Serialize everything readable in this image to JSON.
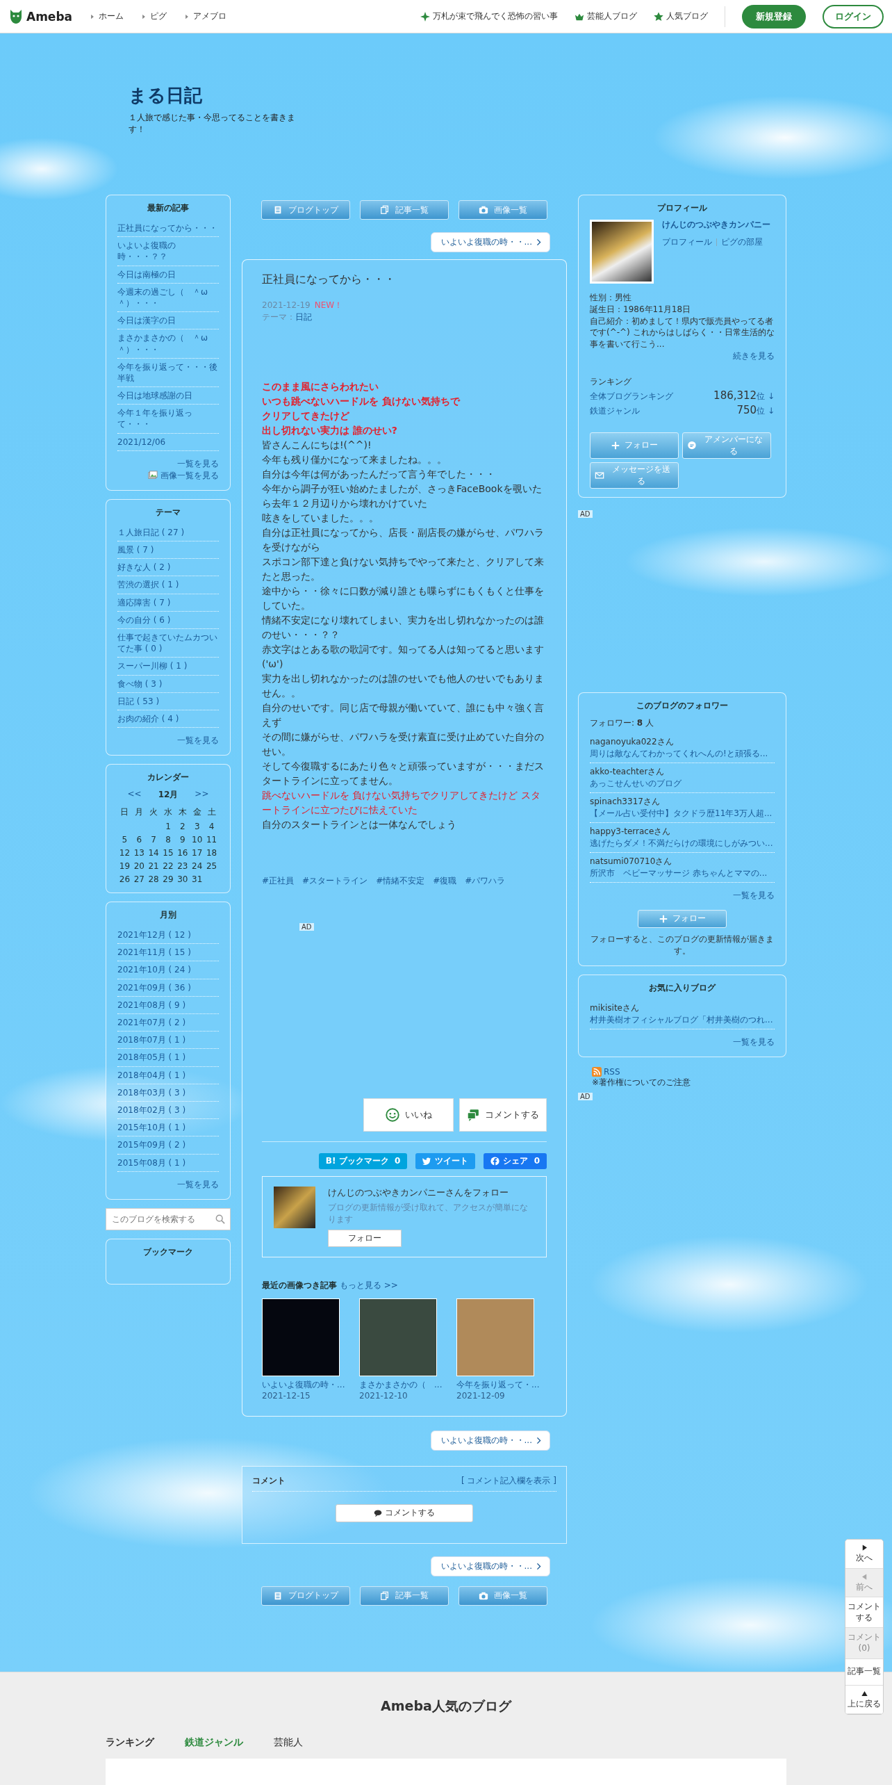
{
  "header": {
    "logo": "Ameba",
    "nav_links": [
      "ホーム",
      "ピグ",
      "アメブロ"
    ],
    "right_links": [
      {
        "text": "万札が束で飛んでく恐怖の習い事",
        "kind": "sparkle"
      },
      {
        "text": "芸能人ブログ",
        "kind": "crown"
      },
      {
        "text": "人気ブログ",
        "kind": "star"
      }
    ],
    "signup": "新規登録",
    "login": "ログイン"
  },
  "blog": {
    "title": "まる日記",
    "description": "１人旅で感じた事・今思ってることを書きます！"
  },
  "latest_articles": {
    "title": "最新の記事",
    "items": [
      "正社員になってから・・・",
      "いよいよ復職の時・・・？？",
      "今日は南極の日",
      "今週末の過ごし（　＾ω＾）・・・",
      "今日は漢字の日",
      "まさかまさかの（　＾ω＾）・・・",
      "今年を振り返って・・・後半戦",
      "今日は地球感謝の日",
      "今年１年を振り返って・・・",
      "2021/12/06"
    ],
    "more": "一覧を見る",
    "image_more": "画像一覧を見る"
  },
  "themes": {
    "title": "テーマ",
    "items": [
      "１人旅日記 ( 27 )",
      "風景 ( 7 )",
      "好きな人 ( 2 )",
      "苦渋の選択 ( 1 )",
      "適応障害 ( 7 )",
      "今の自分 ( 6 )",
      "仕事で起きていたムカついてた事 ( 0 )",
      "スーパー川柳 ( 1 )",
      "食べ物 ( 3 )",
      "日記 ( 53 )",
      "お肉の紹介 ( 4 )"
    ],
    "more": "一覧を見る"
  },
  "calendar": {
    "title": "カレンダー",
    "prev": "<<",
    "month": "12月",
    "next": ">>",
    "weekdays": [
      "日",
      "月",
      "火",
      "水",
      "木",
      "金",
      "土"
    ],
    "weeks": [
      [
        "1",
        "2",
        "3",
        "4"
      ],
      [
        "5",
        "6",
        "7",
        "8",
        "9",
        "10",
        "11"
      ],
      [
        "12",
        "13",
        "14",
        "15",
        "16",
        "17",
        "18"
      ],
      [
        "19",
        "20",
        "21",
        "22",
        "23",
        "24",
        "25"
      ],
      [
        "26",
        "27",
        "28",
        "29",
        "30",
        "31"
      ]
    ]
  },
  "monthly": {
    "title": "月別",
    "items": [
      "2021年12月 ( 12 )",
      "2021年11月 ( 15 )",
      "2021年10月 ( 24 )",
      "2021年09月 ( 36 )",
      "2021年08月 ( 9 )",
      "2021年07月 ( 2 )",
      "2018年07月 ( 1 )",
      "2018年05月 ( 1 )",
      "2018年04月 ( 1 )",
      "2018年03月 ( 3 )",
      "2018年02月 ( 3 )",
      "2015年10月 ( 1 )",
      "2015年09月 ( 2 )",
      "2015年08月 ( 1 )"
    ],
    "more": "一覧を見る"
  },
  "search": {
    "placeholder": "このブログを検索する"
  },
  "bookmark": {
    "title": "ブックマーク"
  },
  "top_nav": [
    {
      "label": "ブログトップ",
      "kind": "doc"
    },
    {
      "label": "記事一覧",
      "kind": "copy"
    },
    {
      "label": "画像一覧",
      "kind": "camera"
    }
  ],
  "prev_link_top": "いよいよ復職の時・・...",
  "article": {
    "title": "正社員になってから・・・",
    "date": "2021-12-19",
    "badge": "NEW！",
    "theme_label": "テーマ：",
    "theme": "日記",
    "lines": [
      {
        "text": "このまま風にさらわれたい",
        "kind": "lyric_bold"
      },
      {
        "text": "いつも跳べないハードルを 負けない気持ちで",
        "kind": "lyric_bold"
      },
      {
        "text": "クリアしてきたけど",
        "kind": "lyric_bold"
      },
      {
        "text": "出し切れない実力は 誰のせい?",
        "kind": "lyric_bold"
      },
      {
        "text": "皆さんこんにちは!(^^)!",
        "kind": "text"
      },
      {
        "text": "今年も残り僅かになって来ましたね。。。",
        "kind": "text"
      },
      {
        "text": "自分は今年は何があったんだって言う年でした・・・",
        "kind": "text"
      },
      {
        "text": "今年から調子が狂い始めたましたが、さっきFaceBookを覗いたら去年１２月辺りから壊れかけていた",
        "kind": "text"
      },
      {
        "text": "呟きをしていました。。。",
        "kind": "text"
      },
      {
        "text": "自分は正社員になってから、店長・副店長の嫌がらせ、パワハラを受けながら",
        "kind": "text"
      },
      {
        "text": "スポコン部下達と負けない気持ちでやって来たと、クリアして来たと思った。",
        "kind": "text"
      },
      {
        "text": "途中から・・徐々に口数が減り誰とも喋らずにもくもくと仕事をしていた。",
        "kind": "text"
      },
      {
        "text": "情緒不安定になり壊れてしまい、実力を出し切れなかったのは誰のせい・・・？？",
        "kind": "text"
      },
      {
        "text": "赤文字はとある歌の歌詞です。知ってる人は知ってると思います('ω')",
        "kind": "text"
      },
      {
        "text": "実力を出し切れなかったのは誰のせいでも他人のせいでもありません。。",
        "kind": "text"
      },
      {
        "text": "自分のせいです。同じ店で母親が働いていて、誰にも中々強く言えず",
        "kind": "text"
      },
      {
        "text": "その間に嫌がらせ、パワハラを受け素直に受け止めていた自分のせい。",
        "kind": "text"
      },
      {
        "text": "そして今復職するにあたり色々と頑張っていますが・・・まだスタートラインに立ってません。",
        "kind": "text"
      },
      {
        "text": "跳べないハードルを 負けない気持ちでクリアしてきたけど スタートラインに立つたびに怯えていた",
        "kind": "lyric"
      },
      {
        "text": "自分のスタートラインとは一体なんでしょう",
        "kind": "text"
      }
    ],
    "tags": [
      "#正社員",
      "#スタートライン",
      "#情緒不安定",
      "#復職",
      "#パワハラ"
    ],
    "ad": "AD",
    "like": "いいね",
    "comment": "コメントする",
    "share": [
      {
        "label": "B! ブックマーク",
        "count": "0",
        "kind": "hatena"
      },
      {
        "label": "ツイート",
        "kind": "twitter"
      },
      {
        "label": "シェア",
        "count": "0",
        "kind": "facebook"
      }
    ],
    "follow": {
      "title": "けんじのつぶやきカンパニーさんをフォロー",
      "note": "ブログの更新情報が受け取れて、アクセスが簡単になります",
      "button": "フォロー"
    },
    "recent": {
      "title": "最近の画像つき記事",
      "more": "もっと見る >>",
      "items": [
        {
          "title": "いよいよ復職の時・...",
          "date": "2021-12-15"
        },
        {
          "title": "まさかまさかの（　...",
          "date": "2021-12-10"
        },
        {
          "title": "今年を振り返って・...",
          "date": "2021-12-09"
        }
      ]
    }
  },
  "prev_link_middle": "いよいよ復職の時・・...",
  "comments": {
    "title": "コメント",
    "toggle": "[ コメント記入欄を表示 ]",
    "button": "コメントする"
  },
  "prev_link_bottom": "いよいよ復職の時・・...",
  "bottom_nav": [
    {
      "label": "ブログトップ",
      "kind": "doc"
    },
    {
      "label": "記事一覧",
      "kind": "copy"
    },
    {
      "label": "画像一覧",
      "kind": "camera"
    }
  ],
  "profile": {
    "title": "プロフィール",
    "name": "けんじのつぶやきカンパニー",
    "links": [
      "プロフィール",
      "ピグの部屋"
    ],
    "gender": "性別：男性",
    "birthday": "誕生日：1986年11月18日",
    "intro": "自己紹介：初めまして！県内で販売員やってる者です(^-^) これからはしばらく・・日常生活的な事を書いて行こう...",
    "more": "続きを見る",
    "ranking_title": "ランキング",
    "rankings": [
      {
        "label": "全体ブログランキング",
        "value": "186,312",
        "unit": "位 ↓"
      },
      {
        "label": "鉄道ジャンル",
        "value": "750",
        "unit": "位 ↓"
      }
    ],
    "buttons": [
      {
        "label": "フォロー",
        "kind": "plus"
      },
      {
        "label": "アメンバーになる",
        "kind": "chat"
      },
      {
        "label": "メッセージを送る",
        "kind": "mail"
      }
    ]
  },
  "right_ad": "AD",
  "followers": {
    "title": "このブログのフォロワー",
    "count": "フォロワー: **8** 人",
    "items": [
      {
        "user": "naganoyuka022",
        "suffix": "さん",
        "blog": "周りは敵なんてわかってくれへんの!と頑張る..."
      },
      {
        "user": "akko-teachter",
        "suffix": "さん",
        "blog": "あっこせんせいのブログ"
      },
      {
        "user": "spinach3317",
        "suffix": "さん",
        "blog": "【メール占い受付中】タクドラ歴11年3万人超..."
      },
      {
        "user": "happy3-terrace",
        "suffix": "さん",
        "blog": "逃げたらダメ！不満だらけの環境にしがみつい..."
      },
      {
        "user": "natsumi070710",
        "suffix": "さん",
        "blog": "所沢市　ベビーマッサージ 赤ちゃんとママの..."
      }
    ],
    "more": "一覧を見る",
    "button": "フォロー",
    "note": "フォローすると、このブログの更新情報が届きます。"
  },
  "favorites": {
    "title": "お気に入りブログ",
    "items": [
      {
        "user": "mikisite",
        "suffix": "さん",
        "blog": "村井美樹オフィシャルブログ「村井美樹のつれ..."
      }
    ],
    "more": "一覧を見る"
  },
  "rss": "RSS",
  "copyright": "※著作権についてのご注意",
  "rss_ad": "AD",
  "side_nav": [
    {
      "label": "次へ",
      "kind": "next",
      "disabled": false
    },
    {
      "label": "前へ",
      "kind": "prev",
      "disabled": true
    },
    {
      "label": "コメントする",
      "kind": "none",
      "disabled": false
    },
    {
      "label": "コメント(0)",
      "kind": "none",
      "disabled": true
    },
    {
      "label": "記事一覧",
      "kind": "none",
      "disabled": false
    },
    {
      "label": "上に戻る",
      "kind": "up",
      "disabled": false
    }
  ],
  "footer": {
    "title": "Ameba人気のブログ",
    "ranking_label": "ランキング",
    "tabs": [
      {
        "label": "鉄道ジャンル",
        "selected": true
      },
      {
        "label": "芸能人",
        "selected": false
      }
    ]
  }
}
